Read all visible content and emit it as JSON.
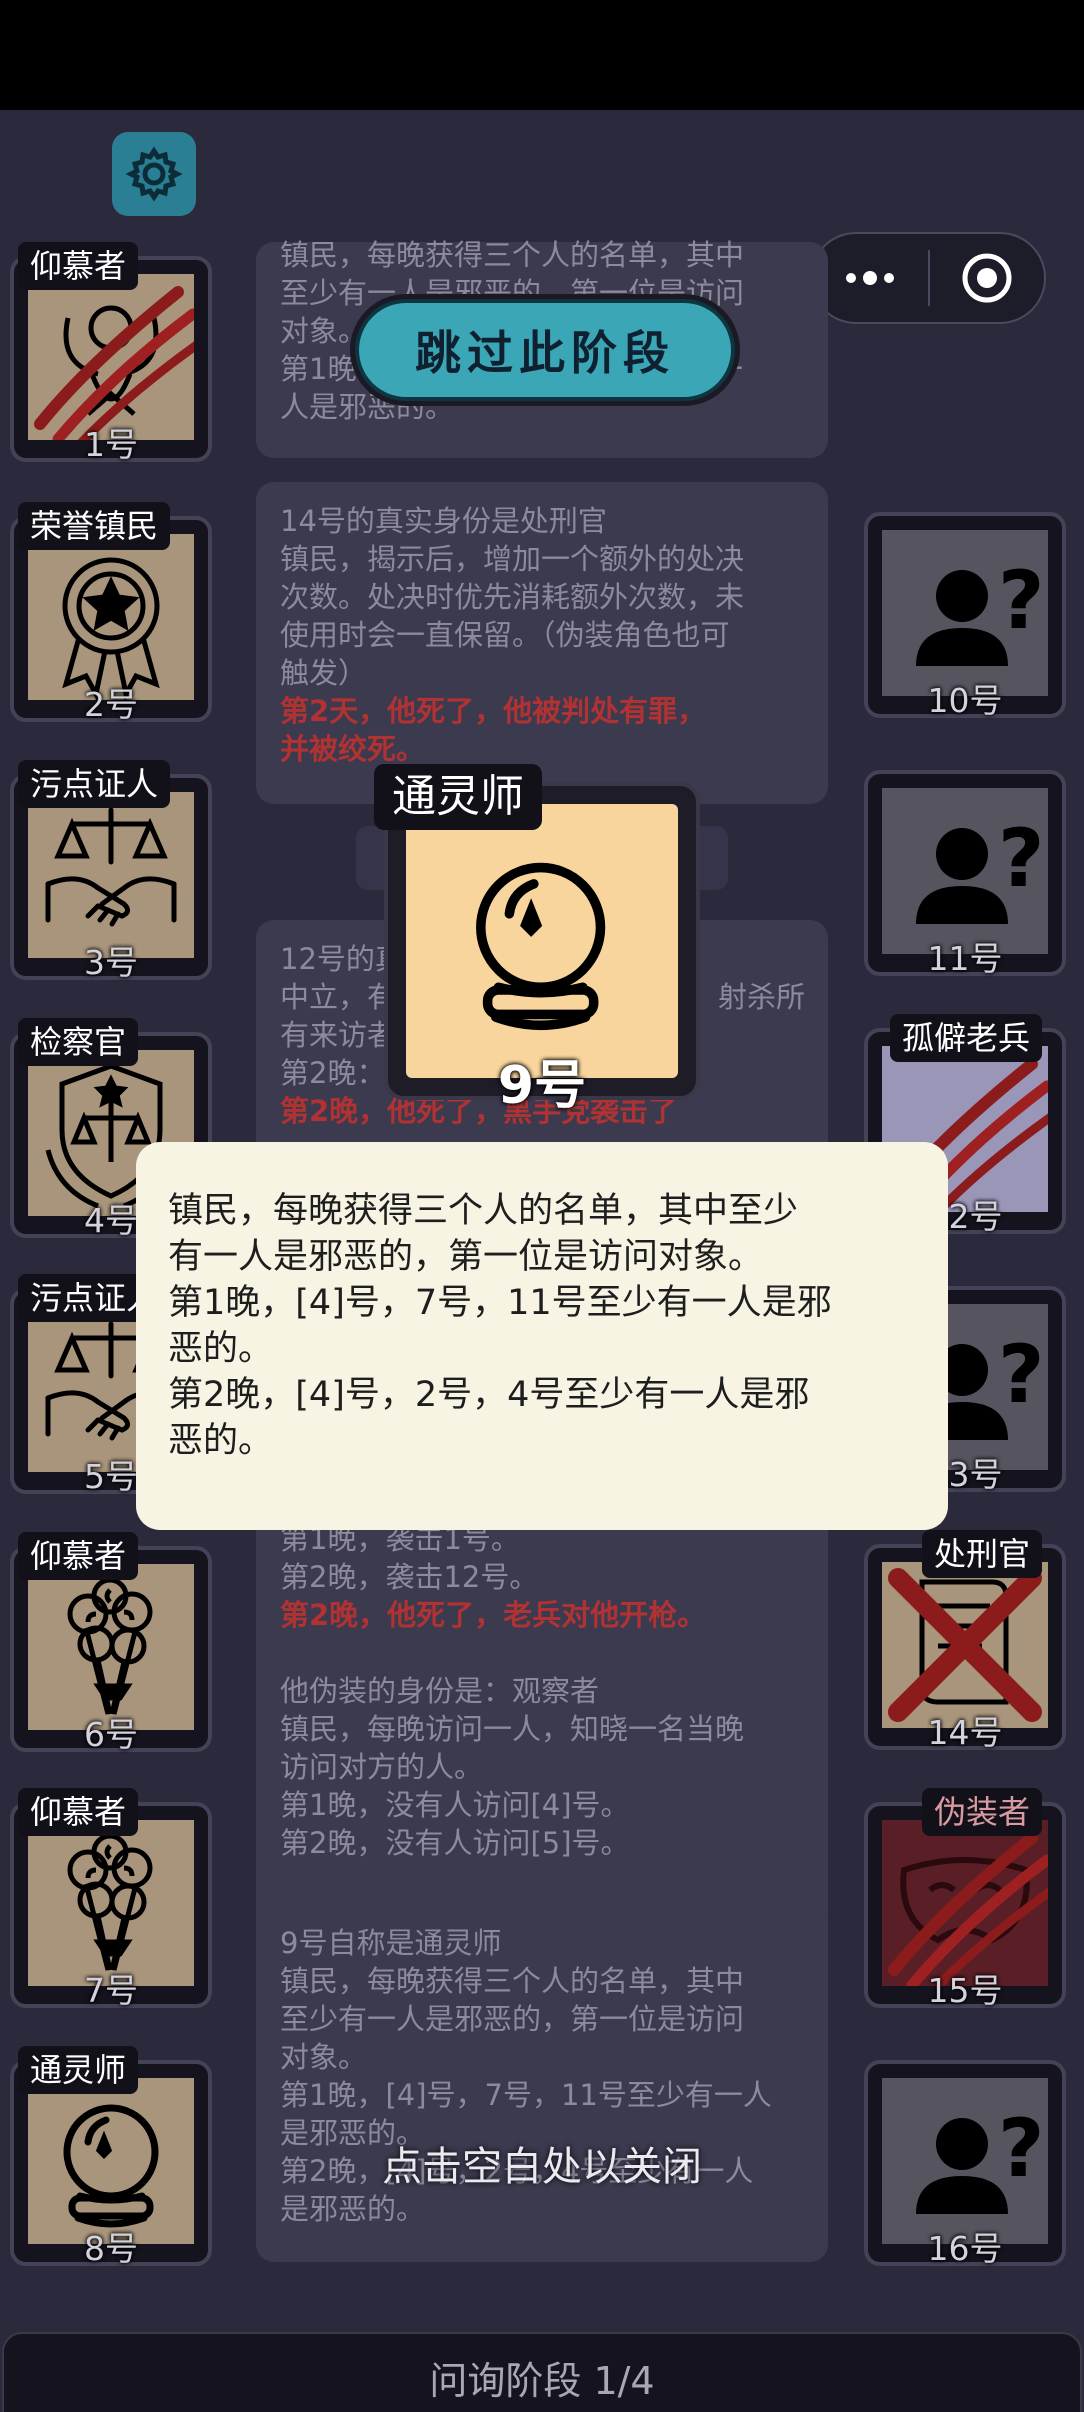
{
  "header": {
    "settings_icon": "gear-icon",
    "capsule_menu_icon": "more-dots-icon",
    "capsule_close_icon": "target-circle-icon"
  },
  "skip_button": {
    "label": "跳过此阶段"
  },
  "left_players": [
    {
      "tag": "仰慕者",
      "number": "1号",
      "icon": "angel-icon",
      "state": "attacked"
    },
    {
      "tag": "荣誉镇民",
      "number": "2号",
      "icon": "medal-star-icon",
      "state": "alive"
    },
    {
      "tag": "污点证人",
      "number": "3号",
      "icon": "scales-handshake-icon",
      "state": "alive"
    },
    {
      "tag": "检察官",
      "number": "4号",
      "icon": "scales-shield-icon",
      "state": "alive"
    },
    {
      "tag": "污点证人",
      "number": "5号",
      "icon": "scales-handshake-icon",
      "state": "alive"
    },
    {
      "tag": "仰慕者",
      "number": "6号",
      "icon": "rose-bouquet-icon",
      "state": "alive"
    },
    {
      "tag": "仰慕者",
      "number": "7号",
      "icon": "rose-bouquet-icon",
      "state": "alive"
    },
    {
      "tag": "通灵师",
      "number": "8号",
      "icon": "crystal-ball-icon",
      "state": "alive"
    }
  ],
  "right_players": [
    {
      "tag": "",
      "number": "10号",
      "icon": "unknown-person-icon",
      "state": "unknown"
    },
    {
      "tag": "",
      "number": "11号",
      "icon": "unknown-person-icon",
      "state": "unknown"
    },
    {
      "tag": "孤僻老兵",
      "number": "12号",
      "icon": "veteran-icon",
      "state": "attacked"
    },
    {
      "tag": "",
      "number": "13号",
      "icon": "unknown-person-icon",
      "state": "unknown"
    },
    {
      "tag": "处刑官",
      "number": "14号",
      "icon": "scroll-icon",
      "state": "executed"
    },
    {
      "tag": "伪装者",
      "number": "15号",
      "icon": "mask-icon",
      "state": "attacked"
    },
    {
      "tag": "",
      "number": "16号",
      "icon": "unknown-person-icon",
      "state": "unknown"
    }
  ],
  "logs": {
    "log1": {
      "lines": [
        "镇民，每晚获得三个人的名单，其中",
        "至少有一人是邪恶的，第一位是访问",
        "对象。",
        "第1晚，[4]号，7号，11号至少有一",
        "人是邪恶的。"
      ]
    },
    "log2": {
      "lines": [
        "14号的真实身份是处刑官",
        "镇民，揭示后，增加一个额外的处决",
        "次数。处决时优先消耗额外次数，未",
        "使用时会一直保留。（伪装角色也可",
        "触发）"
      ],
      "red_lines": [
        "第2天，他死了，他被判处有罪，",
        "并被绞死。"
      ]
    },
    "log3": {
      "lines": [
        "12号的真",
        "中立，有",
        "有来访者",
        "第2晚："
      ],
      "right_fragment": "射杀所",
      "red_line": "第2晚，他死了，黑手党袭击了"
    },
    "log4": {
      "lines": [
        "第1晚，袭击1号。",
        "第2晚，袭击12号。"
      ],
      "red_line": "第2晚，他死了，老兵对他开枪。",
      "lines2": [
        "他伪装的身份是：观察者",
        "镇民，每晚访问一人，知晓一名当晚",
        "访问对方的人。",
        "第1晚，没有人访问[4]号。",
        "第2晚，没有人访问[5]号。"
      ]
    },
    "log5": {
      "lines": [
        "9号自称是通灵师",
        "镇民，每晚获得三个人的名单，其中",
        "至少有一人是邪恶的，第一位是访问",
        "对象。",
        "第1晚，[4]号，7号，11号至少有一人",
        "是邪恶的。",
        "第2晚，[4]号，2号，4号至少有一人",
        "是邪恶的。"
      ]
    }
  },
  "selected_card": {
    "tag": "通灵师",
    "number": "9号",
    "icon": "crystal-ball-icon"
  },
  "popup": {
    "lines": [
      "镇民，每晚获得三个人的名单，其中至少",
      "有一人是邪恶的，第一位是访问对象。",
      "第1晚，[4]号，7号，11号至少有一人是邪",
      "恶的。",
      "第2晚，[4]号，2号，4号至少有一人是邪",
      "恶的。"
    ]
  },
  "close_hint": "点击空白处以关闭",
  "phase_bar": {
    "label": "问询阶段 1/4"
  },
  "colors": {
    "background": "#2b2a3c",
    "accent": "#3aa6b6",
    "evil_red": "#b03232",
    "card_tan": "#a8957c",
    "popup_bg": "#f8f4e4"
  }
}
